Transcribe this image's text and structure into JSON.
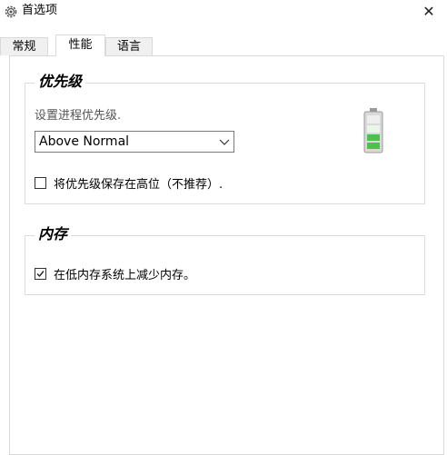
{
  "window": {
    "title": "首选项",
    "close_glyph": "✕"
  },
  "tabs": [
    {
      "label": "常规",
      "active": false
    },
    {
      "label": "性能",
      "active": true
    },
    {
      "label": "语言",
      "active": false
    }
  ],
  "priority": {
    "title": "优先级",
    "hint": "设置进程优先级.",
    "select_value": "Above Normal",
    "checkbox_label": "将优先级保存在高位（不推荐）.",
    "checkbox_checked": false,
    "battery_icon": "battery-icon"
  },
  "memory": {
    "title": "内存",
    "checkbox_label": "在低内存系统上减少内存。",
    "checkbox_checked": true
  },
  "colors": {
    "battery_fill": "#4cc24c",
    "border": "#dcdcdc"
  }
}
